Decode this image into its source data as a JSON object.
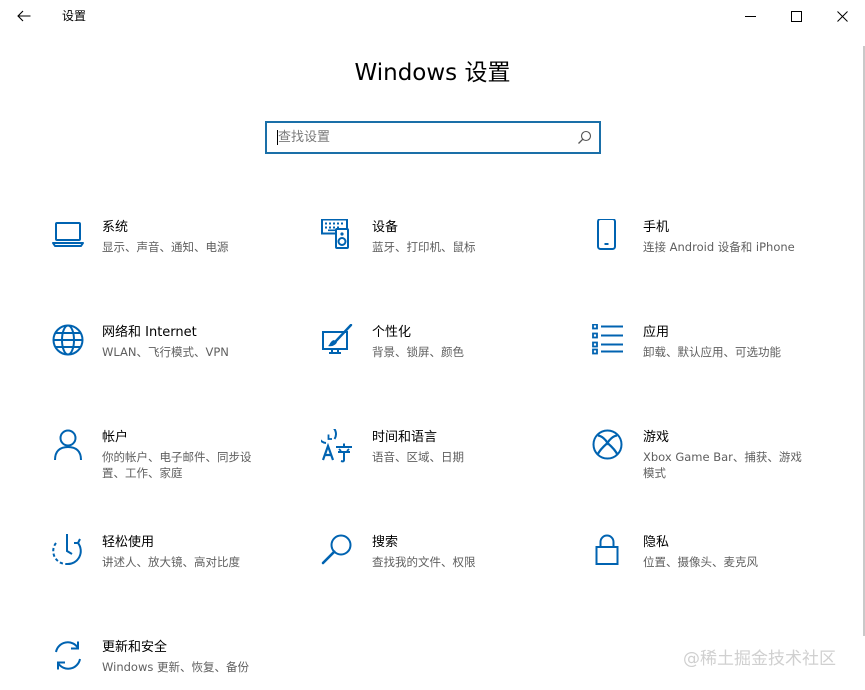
{
  "window": {
    "title": "设置",
    "controls": {
      "back": "back-arrow-icon",
      "minimize": "minimize-icon",
      "maximize": "maximize-icon",
      "close": "close-icon"
    }
  },
  "page": {
    "title": "Windows 设置"
  },
  "search": {
    "placeholder": "查找设置",
    "value": "",
    "icon": "search-icon"
  },
  "colors": {
    "accent": "#0063b1",
    "search_border": "#1a6fa8",
    "description": "#5f5f5f"
  },
  "categories": [
    {
      "id": "system",
      "icon": "laptop-icon",
      "title": "系统",
      "description": "显示、声音、通知、电源"
    },
    {
      "id": "devices",
      "icon": "keyboard-speaker-icon",
      "title": "设备",
      "description": "蓝牙、打印机、鼠标"
    },
    {
      "id": "phone",
      "icon": "phone-icon",
      "title": "手机",
      "description": "连接 Android 设备和 iPhone"
    },
    {
      "id": "network",
      "icon": "globe-icon",
      "title": "网络和 Internet",
      "description": "WLAN、飞行模式、VPN"
    },
    {
      "id": "personalization",
      "icon": "paintbrush-icon",
      "title": "个性化",
      "description": "背景、锁屏、颜色"
    },
    {
      "id": "apps",
      "icon": "apps-list-icon",
      "title": "应用",
      "description": "卸载、默认应用、可选功能"
    },
    {
      "id": "accounts",
      "icon": "person-icon",
      "title": "帐户",
      "description": "你的帐户、电子邮件、同步设置、工作、家庭"
    },
    {
      "id": "time-language",
      "icon": "time-language-icon",
      "title": "时间和语言",
      "description": "语音、区域、日期"
    },
    {
      "id": "gaming",
      "icon": "xbox-icon",
      "title": "游戏",
      "description": "Xbox Game Bar、捕获、游戏模式"
    },
    {
      "id": "ease-of-access",
      "icon": "ease-of-access-icon",
      "title": "轻松使用",
      "description": "讲述人、放大镜、高对比度"
    },
    {
      "id": "search",
      "icon": "magnifier-icon",
      "title": "搜索",
      "description": "查找我的文件、权限"
    },
    {
      "id": "privacy",
      "icon": "lock-icon",
      "title": "隐私",
      "description": "位置、摄像头、麦克风"
    },
    {
      "id": "update-security",
      "icon": "sync-arrows-icon",
      "title": "更新和安全",
      "description": "Windows 更新、恢复、备份"
    }
  ],
  "watermark": "@稀土掘金技术社区"
}
